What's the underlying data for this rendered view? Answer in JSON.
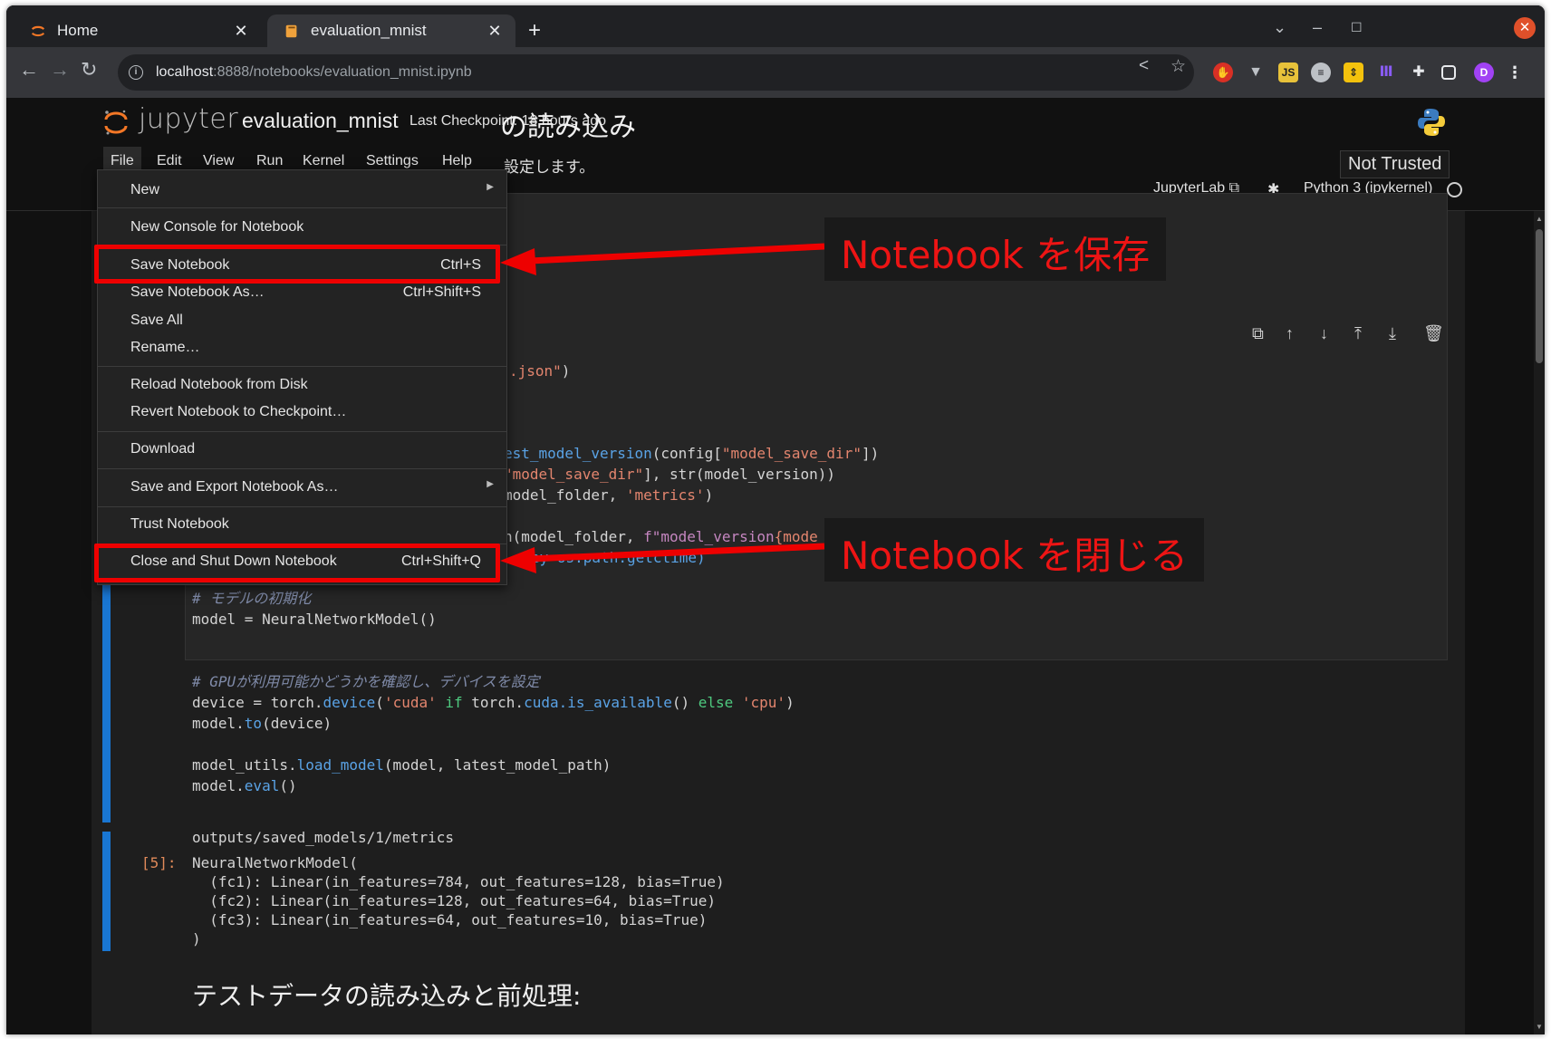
{
  "browser": {
    "tabs": [
      {
        "title": "Home"
      },
      {
        "title": "evaluation_mnist"
      }
    ],
    "url_host": "localhost",
    "url_rest": ":8888/notebooks/evaluation_mnist.ipynb"
  },
  "jupyter": {
    "logo_text": "jupyter",
    "notebook_name": "evaluation_mnist",
    "checkpoint": "Last Checkpoint: 18 hours ago",
    "menu": [
      "File",
      "Edit",
      "View",
      "Run",
      "Kernel",
      "Settings",
      "Help"
    ],
    "not_trusted": "Not Trusted",
    "jupyterlab_link": "JupyterLab",
    "kernel_name": "Python 3 (ipykernel)"
  },
  "file_menu": {
    "new": "New",
    "new_console": "New Console for Notebook",
    "save_notebook": "Save Notebook",
    "save_notebook_shortcut": "Ctrl+S",
    "save_notebook_as": "Save Notebook As…",
    "save_notebook_as_shortcut": "Ctrl+Shift+S",
    "save_all": "Save All",
    "rename": "Rename…",
    "reload": "Reload Notebook from Disk",
    "revert": "Revert Notebook to Checkpoint…",
    "download": "Download",
    "save_export": "Save and Export Notebook As…",
    "trust": "Trust Notebook",
    "close_shutdown": "Close and Shut Down Notebook",
    "close_shutdown_shortcut": "Ctrl+Shift+Q"
  },
  "notebook": {
    "heading1": "の読み込み",
    "para1": "設定します。",
    "code_lines": {
      "l1_a": ".json\"",
      "l1_b": ")",
      "l2_a": "est_model_version",
      "l2_b": "(config[",
      "l2_c": "\"model_save_dir\"",
      "l2_d": "])",
      "l3_a": "\"model_save_dir\"",
      "l3_b": "], str(model_version))",
      "l4_a": "model_folder, ",
      "l4_b": "'metrics'",
      "l4_c": ")",
      "l5_a": "n(model_folder, ",
      "l5_b": "f\"model_version",
      "l5_c": "{mode",
      "l6": "ey=os.path.getctime)",
      "c1": "# モデルの初期化",
      "l7": "model = NeuralNetworkModel()",
      "c2": "# GPUが利用可能かどうかを確認し、デバイスを設定",
      "l8_a": "device = torch.",
      "l8_b": "device",
      "l8_c": "(",
      "l8_d": "'cuda'",
      "l8_e": " if ",
      "l8_f": "torch.",
      "l8_g": "cuda.is_available",
      "l8_h": "() ",
      "l8_i": "else",
      "l8_j": " 'cpu'",
      "l8_k": ")",
      "l9_a": "model.",
      "l9_b": "to",
      "l9_c": "(device)",
      "l10_a": "model_utils.",
      "l10_b": "load_model",
      "l10_c": "(model, latest_model_path)",
      "l11_a": "model.",
      "l11_b": "eval",
      "l11_c": "()"
    },
    "output_path": "outputs/saved_models/1/metrics",
    "prompt": "[5]:",
    "output_lines": [
      "NeuralNetworkModel(",
      "  (fc1): Linear(in_features=784, out_features=128, bias=True)",
      "  (fc2): Linear(in_features=128, out_features=64, bias=True)",
      "  (fc3): Linear(in_features=64, out_features=10, bias=True)",
      ")"
    ],
    "heading2": "テストデータの読み込みと前処理:"
  },
  "annotations": {
    "save_callout": "Notebook を保存",
    "close_callout": "Notebook を閉じる",
    "color": "#ee0000"
  }
}
